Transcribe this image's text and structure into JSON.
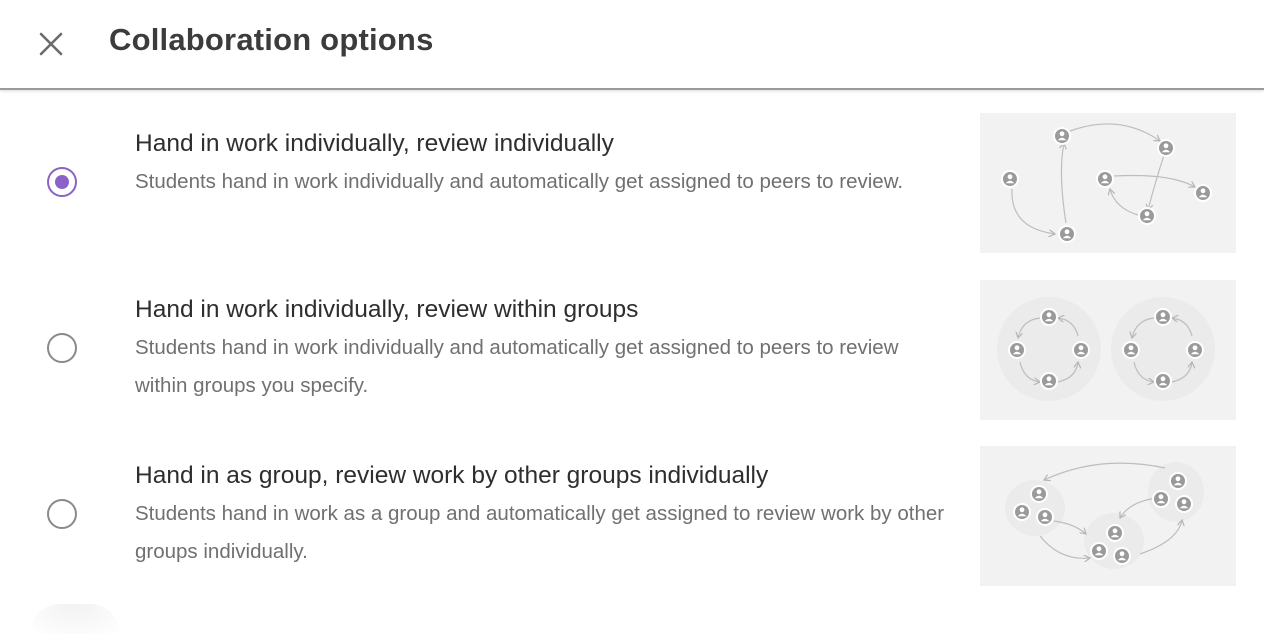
{
  "dialog": {
    "title": "Collaboration options",
    "close_icon": "close-icon"
  },
  "options": [
    {
      "title": "Hand in work individually, review individually",
      "description": "Students hand in work individually and automatically get assigned to peers to review.",
      "selected": true,
      "illustration_icon": "individual-review-diagram-icon"
    },
    {
      "title": "Hand in work individually, review within groups",
      "description": "Students hand in work individually and automatically get assigned to peers to review within groups you specify.",
      "selected": false,
      "illustration_icon": "group-review-diagram-icon"
    },
    {
      "title": "Hand in as group, review work by other groups individually",
      "description": "Students hand in work as a group and automatically get assigned to review work by other groups individually.",
      "selected": false,
      "illustration_icon": "cross-group-review-diagram-icon"
    }
  ],
  "colors": {
    "accent": "#8a63c8",
    "radio_border": "#8a8a8a",
    "illustration_bg": "#f2f2f2",
    "person_icon": "#9a9a9a"
  }
}
